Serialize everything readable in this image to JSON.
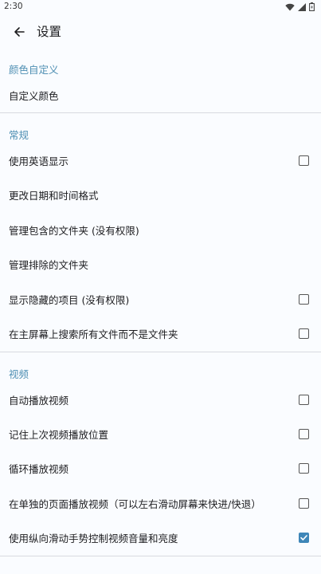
{
  "status_bar": {
    "time": "2:30"
  },
  "app_bar": {
    "title": "设置"
  },
  "sections": {
    "color": {
      "header": "颜色自定义",
      "items": [
        {
          "label": "自定义颜色"
        }
      ]
    },
    "general": {
      "header": "常规",
      "items": [
        {
          "label": "使用英语显示",
          "checked": false
        },
        {
          "label": "更改日期和时间格式"
        },
        {
          "label": "管理包含的文件夹 (没有权限)"
        },
        {
          "label": "管理排除的文件夹"
        },
        {
          "label": "显示隐藏的项目 (没有权限)",
          "checked": false
        },
        {
          "label": "在主屏幕上搜索所有文件而不是文件夹",
          "checked": false
        }
      ]
    },
    "video": {
      "header": "视频",
      "items": [
        {
          "label": "自动播放视频",
          "checked": false
        },
        {
          "label": "记住上次视频播放位置",
          "checked": false
        },
        {
          "label": "循环播放视频",
          "checked": false
        },
        {
          "label": "在单独的页面播放视频（可以左右滑动屏幕来快进/快退）",
          "checked": false
        },
        {
          "label": "使用纵向滑动手势控制视频音量和亮度",
          "checked": true
        }
      ]
    }
  },
  "colors": {
    "section_header": "#4f8fb3",
    "checkbox_checked": "#3e86b8"
  }
}
